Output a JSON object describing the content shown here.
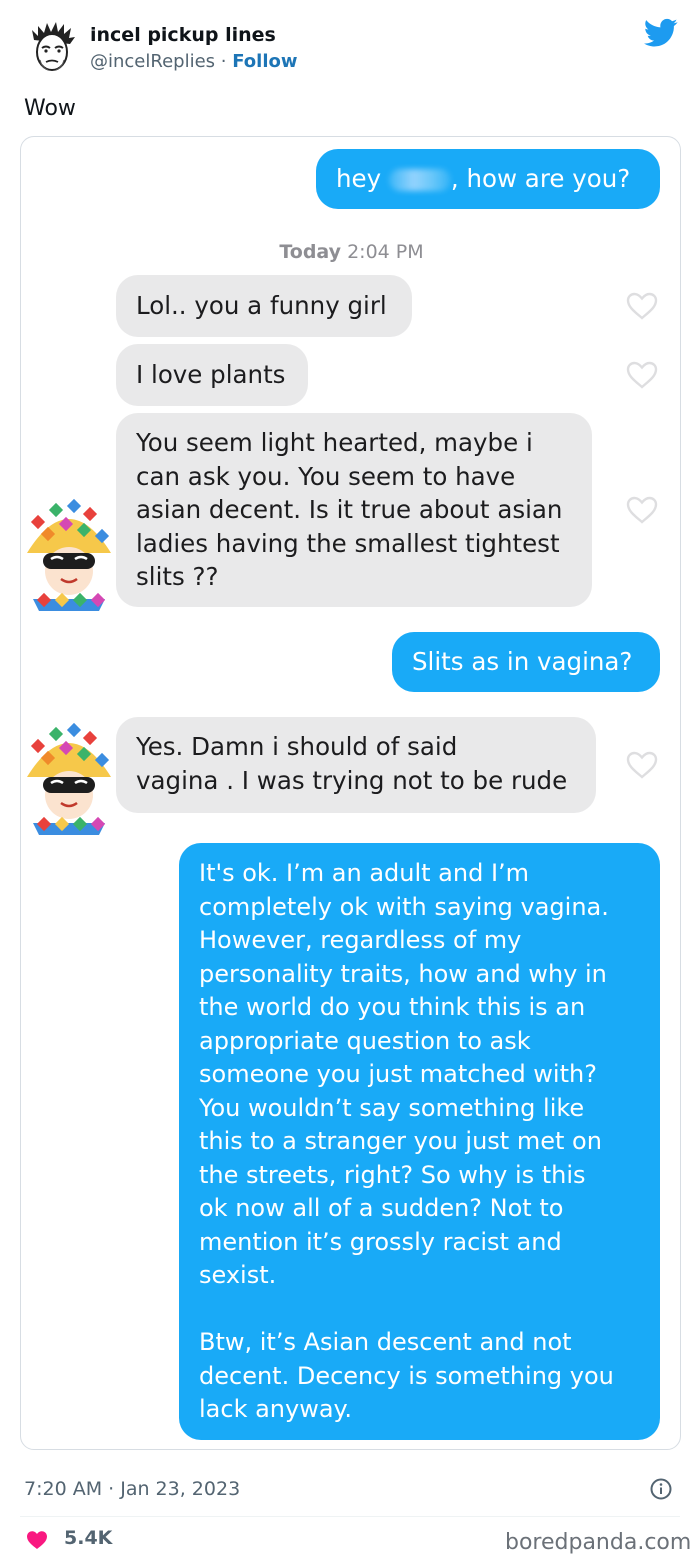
{
  "tweet": {
    "author_name": "incel pickup lines",
    "handle": "@incelReplies",
    "separator": " · ",
    "follow_label": "Follow",
    "text": "Wow",
    "time": "7:20 AM · Jan 23, 2023",
    "likes": "5.4K",
    "watermark": "boredpanda.com"
  },
  "chat": {
    "msg1_prefix": "hey ",
    "msg1_suffix": ", how are you?",
    "time_day": "Today",
    "time_clock": " 2:04 PM",
    "msg2": "Lol.. you a funny girl",
    "msg3": "I love plants",
    "msg4_lines": [
      "You seem light hearted, maybe i",
      "can ask you. You seem to have",
      "asian decent. Is it true about asian",
      "ladies having the smallest tightest",
      "slits ??"
    ],
    "msg5": "Slits as in vagina?",
    "msg6_lines": [
      "Yes. Damn i should of said",
      "vagina . I was trying not to be rude"
    ],
    "msg7_lines": [
      "It's ok. I’m an adult and I’m",
      "completely ok with saying vagina.",
      "However, regardless of my",
      "personality traits, how and why in",
      "the world do you think this is an",
      "appropriate question to ask",
      "someone you just matched with?",
      "You wouldn’t say something like",
      "this to a stranger you just met on",
      "the streets, right? So why is this",
      "ok now all of a sudden? Not to",
      "mention it’s grossly racist and",
      "sexist.",
      "",
      "Btw, it’s Asian descent and not",
      "decent. Decency is something you",
      "lack anyway."
    ]
  },
  "colors": {
    "outgoing_bubble": "#19aaf7",
    "incoming_bubble": "#e9e9ea",
    "twitter_blue": "#1d9bf0",
    "like_red": "#f91880"
  },
  "icons": {
    "brand": "twitter-bird-icon",
    "info": "info-icon",
    "like": "heart-icon",
    "reaction": "heart-outline-icon"
  }
}
